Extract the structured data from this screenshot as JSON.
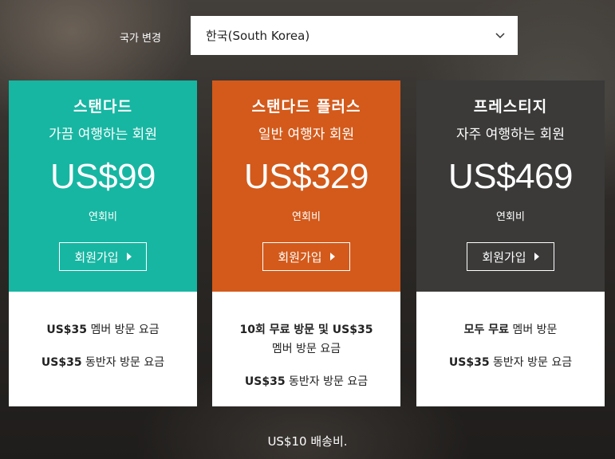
{
  "country": {
    "label": "국가 변경",
    "selected": "한국(South Korea)"
  },
  "plans": [
    {
      "title": "스탠다드",
      "subtitle": "가끔 여행하는 회원",
      "price": "US$99",
      "period": "연회비",
      "join_label": "회원가입",
      "color": "#17b6a2",
      "features": [
        {
          "bold": "US$35",
          "text": " 멤버 방문 요금"
        },
        {
          "bold": "US$35",
          "text": " 동반자 방문 요금"
        }
      ]
    },
    {
      "title": "스탠다드 플러스",
      "subtitle": "일반 여행자 회원",
      "price": "US$329",
      "period": "연회비",
      "join_label": "회원가입",
      "color": "#d35a1b",
      "features": [
        {
          "bold": "10회 무료 방문 및 US$35",
          "text": " 멤버 방문 요금"
        },
        {
          "bold": "US$35",
          "text": " 동반자 방문 요금"
        }
      ]
    },
    {
      "title": "프레스티지",
      "subtitle": "자주 여행하는 회원",
      "price": "US$469",
      "period": "연회비",
      "join_label": "회원가입",
      "color": "#3b3a39",
      "features": [
        {
          "bold": "모두 무료",
          "text": " 멤버 방문"
        },
        {
          "bold": "US$35",
          "text": " 동반자 방문 요금"
        }
      ]
    }
  ],
  "shipping_note": "US$10 배송비."
}
